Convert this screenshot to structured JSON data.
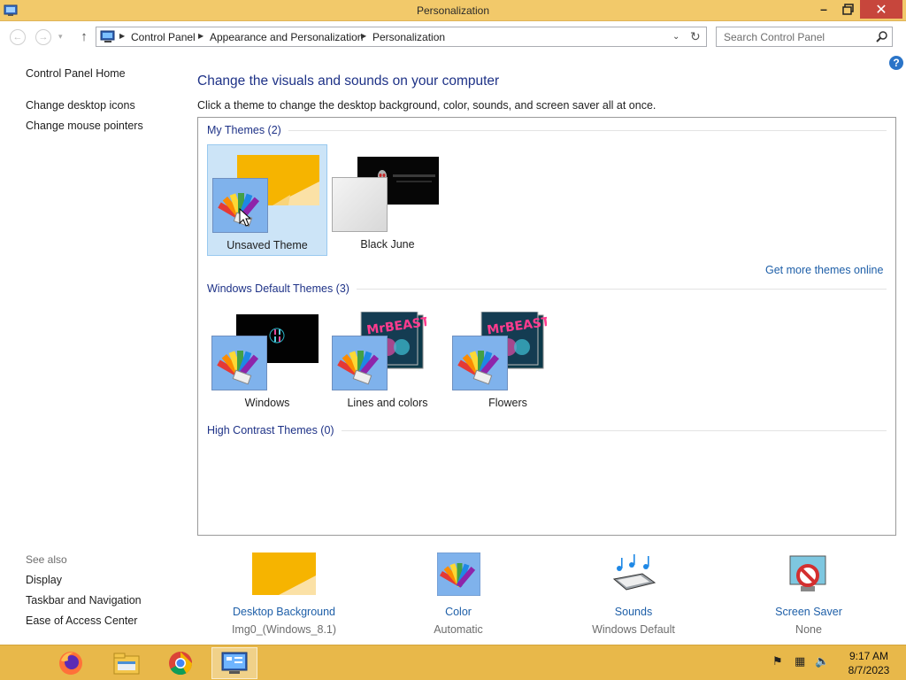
{
  "window": {
    "title": "Personalization",
    "minimize_glyph": "–",
    "close_glyph": "✕"
  },
  "address": {
    "crumbs": [
      "Control Panel",
      "Appearance and Personalization",
      "Personalization"
    ],
    "search_placeholder": "Search Control Panel"
  },
  "left_pane": {
    "links": [
      "Control Panel Home",
      "Change desktop icons",
      "Change mouse pointers"
    ],
    "see_also_title": "See also",
    "see_also": [
      "Display",
      "Taskbar and Navigation",
      "Ease of Access Center"
    ]
  },
  "main": {
    "heading": "Change the visuals and sounds on your computer",
    "subheading": "Click a theme to change the desktop background, color, sounds, and screen saver all at once.",
    "groups": [
      {
        "title": "My Themes (2)"
      },
      {
        "title": "Windows Default Themes (3)"
      },
      {
        "title": "High Contrast Themes (0)"
      }
    ],
    "my_themes": [
      {
        "name": "Unsaved Theme",
        "selected": true
      },
      {
        "name": "Black June",
        "selected": false
      }
    ],
    "default_themes": [
      {
        "name": "Windows"
      },
      {
        "name": "Lines and colors"
      },
      {
        "name": "Flowers"
      }
    ],
    "get_more": "Get more themes online"
  },
  "bottom": {
    "desktop_background": {
      "label": "Desktop Background",
      "value": "Img0_(Windows_8.1)"
    },
    "color": {
      "label": "Color",
      "value": "Automatic"
    },
    "sounds": {
      "label": "Sounds",
      "value": "Windows Default"
    },
    "screen_saver": {
      "label": "Screen Saver",
      "value": "None"
    }
  },
  "taskbar": {
    "apps": [
      "firefox-icon",
      "file-explorer-icon",
      "chrome-icon",
      "control-panel-icon"
    ],
    "time": "9:17 AM",
    "date": "8/7/2023"
  },
  "colors": {
    "title_bar": "#f2c96a",
    "taskbar": "#e8b84a",
    "link": "#1e5fa8",
    "heading": "#1e3287",
    "selection": "#cce4f7"
  }
}
